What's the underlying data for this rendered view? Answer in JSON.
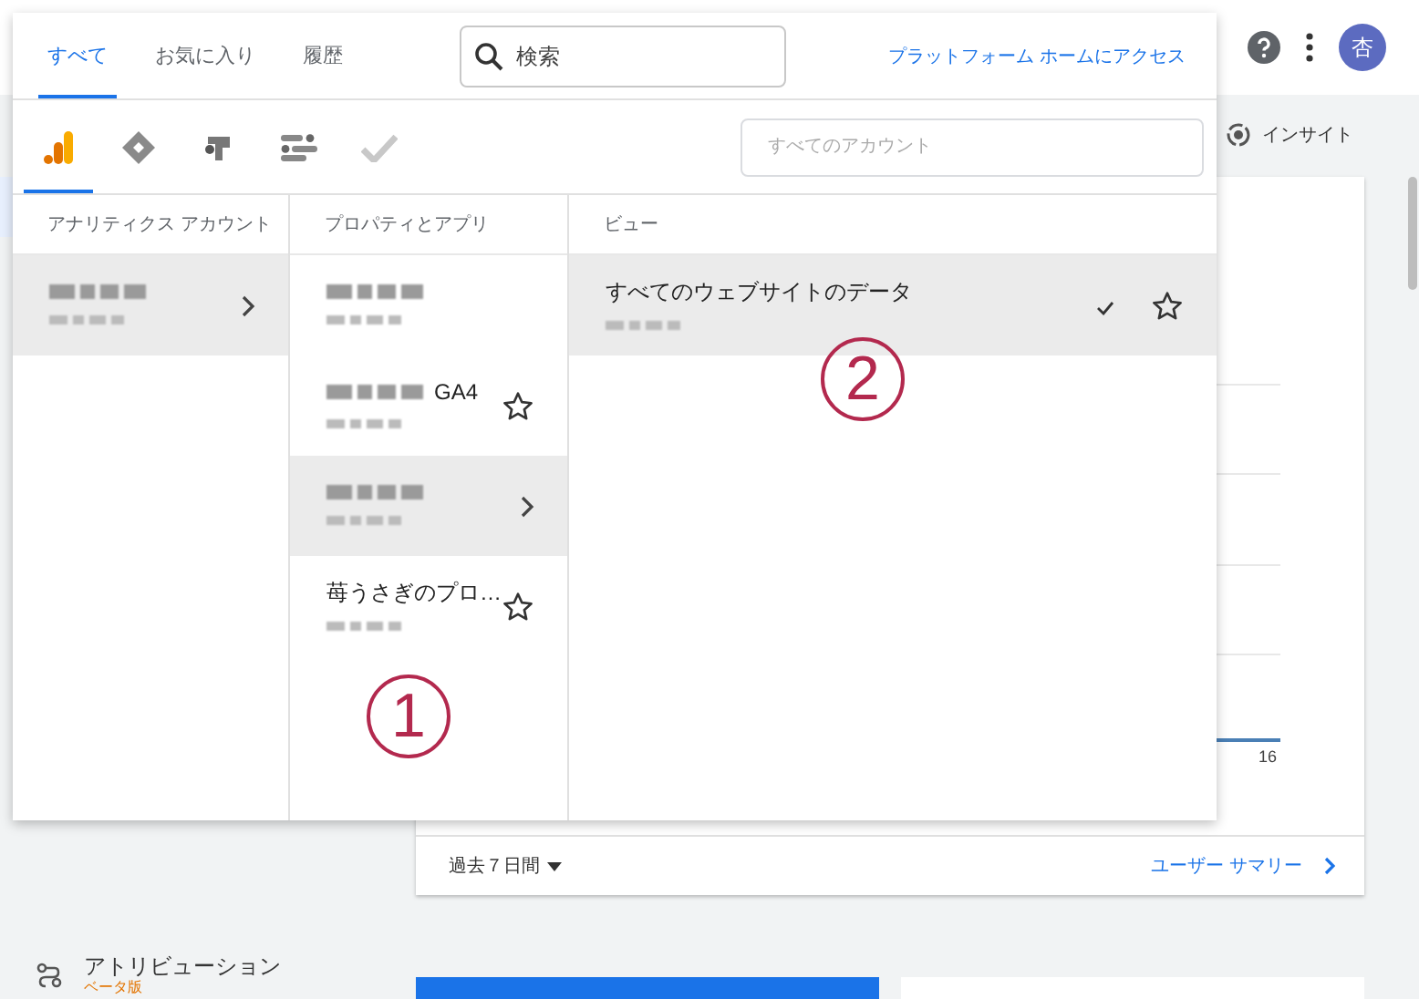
{
  "top_bar": {
    "avatar_letter": "杏"
  },
  "insights_button": {
    "label": "インサイト"
  },
  "report_card": {
    "axis_label": "16",
    "date_range": "過去７日間",
    "link": "ユーザー サマリー"
  },
  "sidebar": {
    "items": [
      {
        "label": "アトリビューション",
        "badge": "ベータ版"
      }
    ]
  },
  "picker": {
    "tabs": [
      {
        "label": "すべて",
        "selected": true
      },
      {
        "label": "お気に入り",
        "selected": false
      },
      {
        "label": "履歴",
        "selected": false
      }
    ],
    "search": {
      "placeholder": "検索"
    },
    "platform_link": "プラットフォーム ホームにアクセス",
    "products": [
      {
        "kind": "analytics",
        "selected": true
      },
      {
        "kind": "tag-manager",
        "selected": false
      },
      {
        "kind": "optimize",
        "selected": false
      },
      {
        "kind": "data-studio",
        "selected": false
      },
      {
        "kind": "surveys",
        "selected": false
      }
    ],
    "account_filter": {
      "placeholder": "すべてのアカウント"
    },
    "columns": [
      {
        "title": "アナリティクス アカウント",
        "items": [
          {
            "title_blurred": true,
            "selected": true,
            "has_children": true
          }
        ]
      },
      {
        "title": "プロパティとアプリ",
        "annotation": "1",
        "items": [
          {
            "title_blurred": true,
            "selected": false
          },
          {
            "title_blurred": true,
            "title": "GA4",
            "selected": false,
            "favorite": false
          },
          {
            "title_blurred": true,
            "selected": true,
            "has_children": true
          },
          {
            "title_blurred": false,
            "title": "苺うさぎのプロ…",
            "selected": false,
            "favorite": false
          }
        ]
      },
      {
        "title": "ビュー",
        "annotation": "2",
        "items": [
          {
            "title_blurred": false,
            "title": "すべてのウェブサイトのデータ",
            "selected": true,
            "checked": true,
            "favorite": false
          }
        ]
      }
    ]
  }
}
